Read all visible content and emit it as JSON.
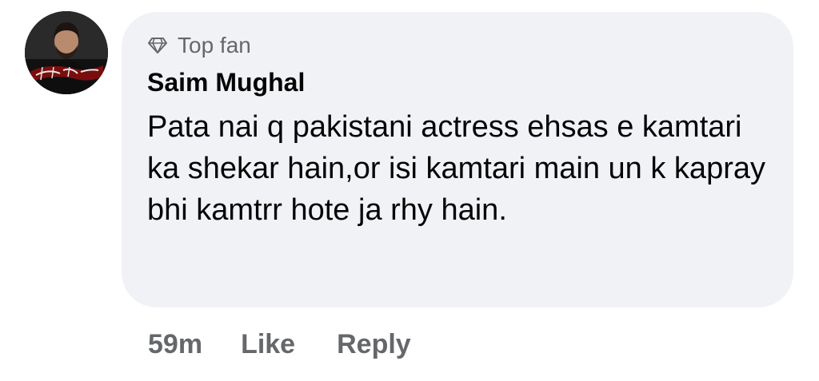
{
  "comment": {
    "avatar_icon": "profile-photo",
    "badge": {
      "icon": "diamond-icon",
      "label": "Top fan"
    },
    "author": "Saim Mughal",
    "text": "Pata nai q pakistani actress ehsas e kamtari ka shekar hain,or isi kamtari main un k kapray bhi kamtrr hote ja rhy hain.",
    "timestamp": "59m",
    "like_label": "Like",
    "reply_label": "Reply"
  },
  "colors": {
    "bubble_bg": "#f0f2f5",
    "text_primary": "#050505",
    "text_secondary": "#65676b"
  }
}
